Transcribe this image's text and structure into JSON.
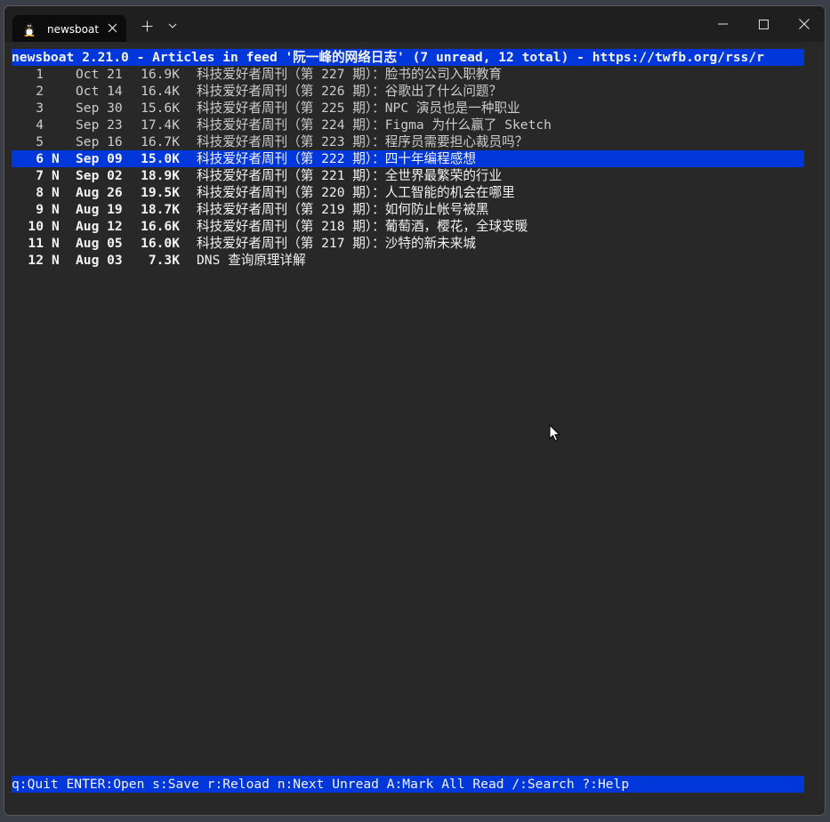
{
  "window": {
    "tab_title": "newsboat",
    "tab_icon": "linux-tux-icon"
  },
  "header": {
    "text": "newsboat 2.21.0 - Articles in feed '阮一峰的网络日志' (7 unread, 12 total) - https://twfb.org/rss/r"
  },
  "articles": [
    {
      "idx": "1",
      "flag": "",
      "date": "Oct 21",
      "size": "16.9K",
      "title": "科技爱好者周刊（第 227 期）：脸书的公司入职教育",
      "unread": false,
      "selected": false
    },
    {
      "idx": "2",
      "flag": "",
      "date": "Oct 14",
      "size": "16.4K",
      "title": "科技爱好者周刊（第 226 期）：谷歌出了什么问题？",
      "unread": false,
      "selected": false
    },
    {
      "idx": "3",
      "flag": "",
      "date": "Sep 30",
      "size": "15.6K",
      "title": "科技爱好者周刊（第 225 期）：NPC 演员也是一种职业",
      "unread": false,
      "selected": false
    },
    {
      "idx": "4",
      "flag": "",
      "date": "Sep 23",
      "size": "17.4K",
      "title": "科技爱好者周刊（第 224 期）：Figma 为什么赢了 Sketch",
      "unread": false,
      "selected": false
    },
    {
      "idx": "5",
      "flag": "",
      "date": "Sep 16",
      "size": "16.7K",
      "title": "科技爱好者周刊（第 223 期）：程序员需要担心裁员吗？",
      "unread": false,
      "selected": false
    },
    {
      "idx": "6",
      "flag": "N",
      "date": "Sep 09",
      "size": "15.0K",
      "title": "科技爱好者周刊（第 222 期）：四十年编程感想",
      "unread": true,
      "selected": true
    },
    {
      "idx": "7",
      "flag": "N",
      "date": "Sep 02",
      "size": "18.9K",
      "title": "科技爱好者周刊（第 221 期）：全世界最繁荣的行业",
      "unread": true,
      "selected": false
    },
    {
      "idx": "8",
      "flag": "N",
      "date": "Aug 26",
      "size": "19.5K",
      "title": "科技爱好者周刊（第 220 期）：人工智能的机会在哪里",
      "unread": true,
      "selected": false
    },
    {
      "idx": "9",
      "flag": "N",
      "date": "Aug 19",
      "size": "18.7K",
      "title": "科技爱好者周刊（第 219 期）：如何防止帐号被黑",
      "unread": true,
      "selected": false
    },
    {
      "idx": "10",
      "flag": "N",
      "date": "Aug 12",
      "size": "16.6K",
      "title": "科技爱好者周刊（第 218 期）：葡萄酒，樱花，全球变暖",
      "unread": true,
      "selected": false
    },
    {
      "idx": "11",
      "flag": "N",
      "date": "Aug 05",
      "size": "16.0K",
      "title": "科技爱好者周刊（第 217 期）：沙特的新未来城",
      "unread": true,
      "selected": false
    },
    {
      "idx": "12",
      "flag": "N",
      "date": "Aug 03",
      "size": "7.3K",
      "title": "DNS 查询原理详解",
      "unread": true,
      "selected": false
    }
  ],
  "status": {
    "text": "q:Quit ENTER:Open s:Save r:Reload n:Next Unread A:Mark All Read /:Search ?:Help"
  },
  "colors": {
    "highlight": "#0037da",
    "terminal_bg": "#282828",
    "read_text": "#cccccc",
    "unread_text": "#f2f2f2"
  }
}
